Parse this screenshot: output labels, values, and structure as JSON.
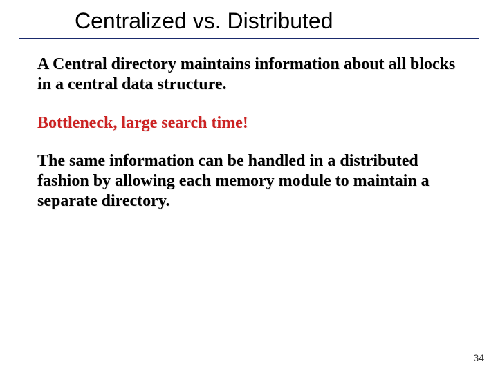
{
  "slide": {
    "title": "Centralized vs. Distributed",
    "paragraphs": {
      "p1": "A Central directory maintains information about all blocks in a central data structure.",
      "p2": "Bottleneck, large search time!",
      "p3": "The same information can be handled in a distributed fashion by allowing each memory module to maintain a separate directory."
    },
    "page_number": "34"
  },
  "colors": {
    "rule": "#1a2a6c",
    "highlight": "#cc2222"
  }
}
